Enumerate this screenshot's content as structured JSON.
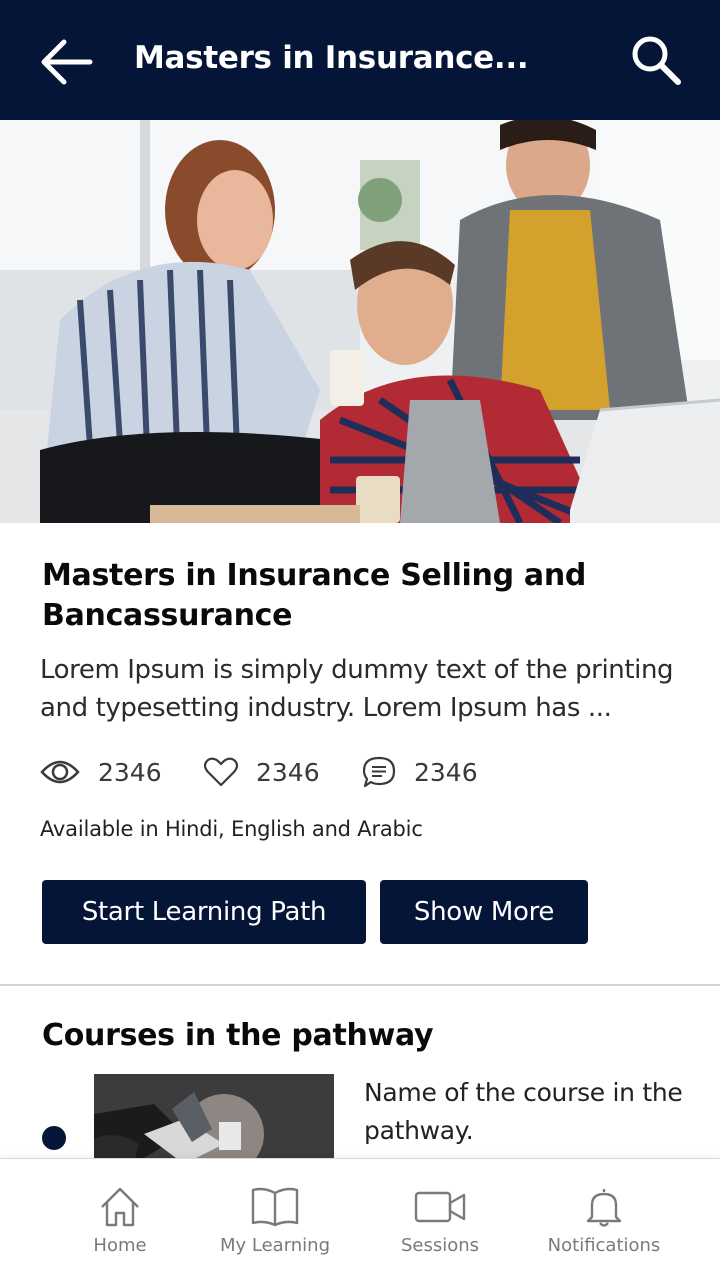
{
  "header": {
    "title": "Masters in Insurance...",
    "back_icon": "arrow-left-icon",
    "search_icon": "search-icon",
    "background_color": "#041538"
  },
  "hero": {
    "icon": "photo-three-people-laptop"
  },
  "course": {
    "title": "Masters in Insurance Selling and Bancassurance",
    "description": "Lorem Ipsum is simply dummy text of the printing and typesetting industry. Lorem Ipsum has ...",
    "stats": {
      "views": "2346",
      "likes": "2346",
      "comments": "2346"
    },
    "languages": "Available in Hindi, English and Arabic",
    "start_button": "Start Learning Path",
    "more_button": "Show More"
  },
  "pathway": {
    "title": "Courses in the pathway",
    "items": [
      {
        "name": "Name of the course in the pathway."
      }
    ]
  },
  "bottom_nav": {
    "items": [
      {
        "label": "Home",
        "icon": "home-icon"
      },
      {
        "label": "My Learning",
        "icon": "book-icon"
      },
      {
        "label": "Sessions",
        "icon": "video-camera-icon"
      },
      {
        "label": "Notifications",
        "icon": "bell-icon"
      }
    ]
  },
  "colors": {
    "primary": "#041538",
    "text": "#222222",
    "muted": "#7a7a7a"
  }
}
